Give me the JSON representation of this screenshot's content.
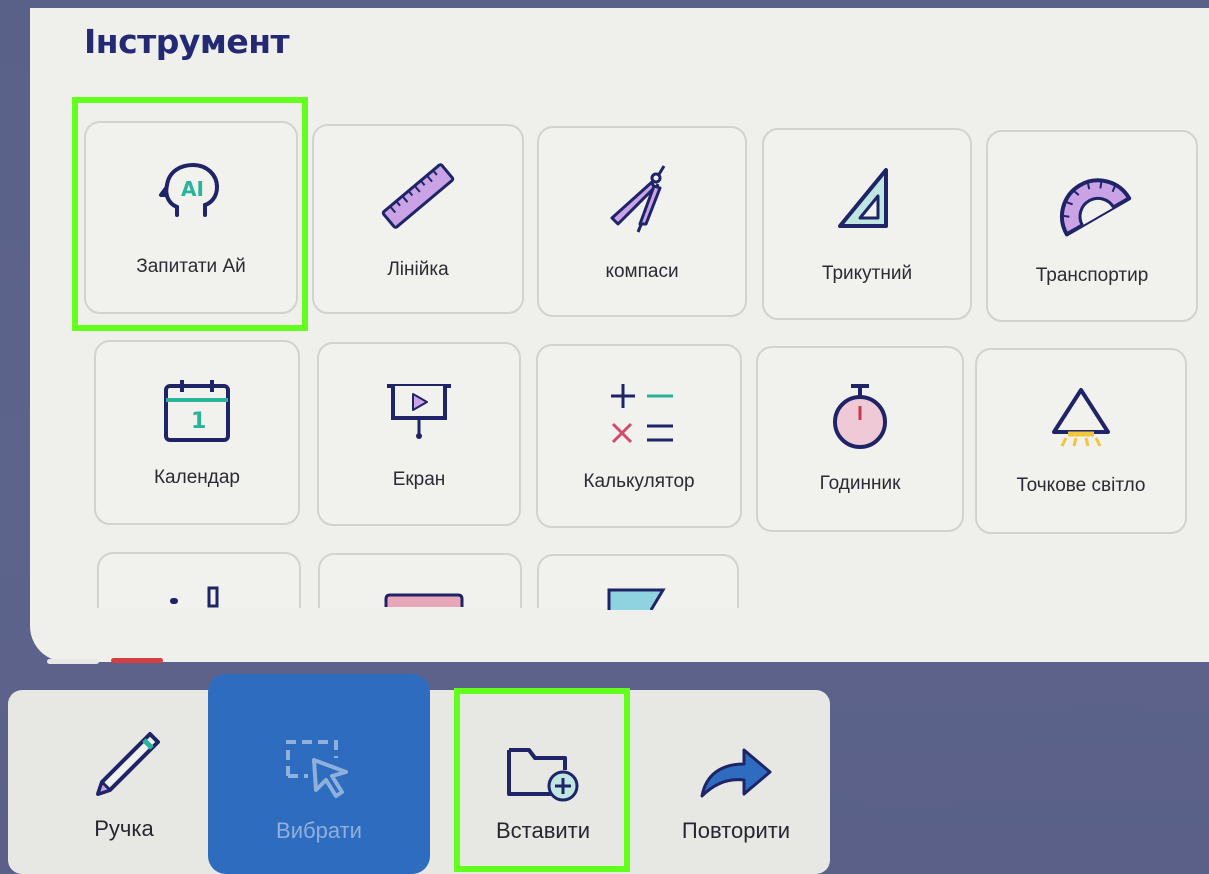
{
  "panel": {
    "title": "Інструмент",
    "tools_row1": [
      {
        "label": "Запитати Ай",
        "icon": "ai-head-icon"
      },
      {
        "label": "Лінійка",
        "icon": "ruler-icon"
      },
      {
        "label": "компаси",
        "icon": "compass-icon"
      },
      {
        "label": "Трикутний",
        "icon": "triangle-icon"
      },
      {
        "label": "Транспортир",
        "icon": "protractor-icon"
      }
    ],
    "tools_row2": [
      {
        "label": "Календар",
        "icon": "calendar-icon"
      },
      {
        "label": "Екран",
        "icon": "screen-icon"
      },
      {
        "label": "Калькулятор",
        "icon": "calculator-icon"
      },
      {
        "label": "Годинник",
        "icon": "stopwatch-icon"
      },
      {
        "label": "Точкове світло",
        "icon": "spotlight-icon"
      }
    ],
    "ai_icon_text": "AI",
    "calendar_day": "1",
    "page_indicator": {
      "active_page": 2,
      "total_pages": 2
    }
  },
  "toolbar": {
    "pen": "Ручка",
    "select": "Вибрати",
    "insert": "Вставити",
    "redo": "Повторити"
  },
  "colors": {
    "highlight": "#63ff1d",
    "accent_blue": "#2e6cbf",
    "title_navy": "#232a73",
    "icon_purple": "#c9a3e6",
    "icon_teal": "#2bb39a"
  }
}
